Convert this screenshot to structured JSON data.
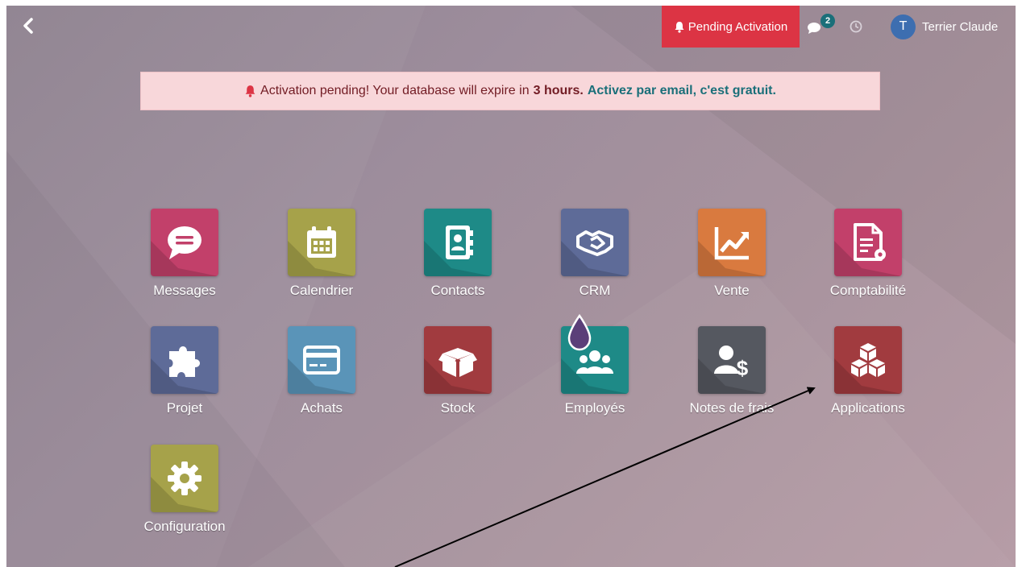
{
  "navbar": {
    "pending_label": "Pending Activation",
    "chat_badge": "2",
    "user_initial": "T",
    "user_name": "Terrier Claude"
  },
  "alert": {
    "text_before": "Activation pending! Your database will expire in",
    "strong": "3 hours",
    "period": ".",
    "link": "Activez par email, c'est gratuit."
  },
  "apps": [
    {
      "label": "Messages",
      "color": "#c2406a",
      "icon": "message-icon"
    },
    {
      "label": "Calendrier",
      "color": "#a6a24a",
      "icon": "calendar-icon"
    },
    {
      "label": "Contacts",
      "color": "#1e8a87",
      "icon": "address-book-icon"
    },
    {
      "label": "CRM",
      "color": "#5e6b98",
      "icon": "handshake-icon"
    },
    {
      "label": "Vente",
      "color": "#d97a3f",
      "icon": "sales-chart-icon"
    },
    {
      "label": "Comptabilité",
      "color": "#c2406a",
      "icon": "invoice-icon"
    },
    {
      "label": "Projet",
      "color": "#5e6b98",
      "icon": "puzzle-icon"
    },
    {
      "label": "Achats",
      "color": "#5a94b8",
      "icon": "credit-card-icon"
    },
    {
      "label": "Stock",
      "color": "#a13b3f",
      "icon": "box-icon"
    },
    {
      "label": "Employés",
      "color": "#1e8a87",
      "icon": "users-icon"
    },
    {
      "label": "Notes de frais",
      "color": "#555860",
      "icon": "expense-icon"
    },
    {
      "label": "Applications",
      "color": "#a13b3f",
      "icon": "cubes-icon"
    },
    {
      "label": "Configuration",
      "color": "#a6a24a",
      "icon": "gear-icon"
    }
  ],
  "colors": {
    "pending": "#dc3444",
    "badge": "#1a6f79",
    "alert_bg": "#f8d7da",
    "alert_text": "#721c24",
    "avatar": "#3d6eb0"
  }
}
